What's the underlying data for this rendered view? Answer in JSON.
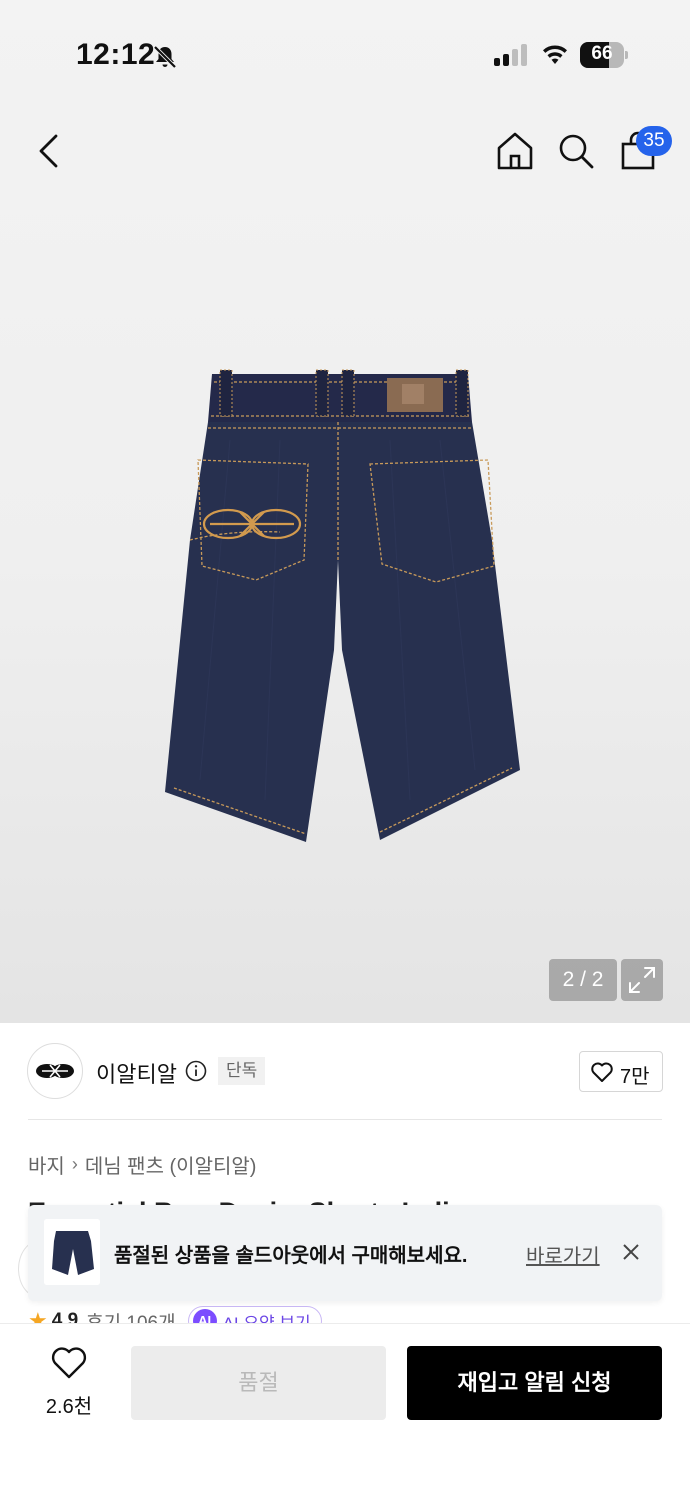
{
  "status_bar": {
    "time": "12:12",
    "battery": "66",
    "battery_level": 0.66
  },
  "header": {
    "cart_count": "35"
  },
  "gallery": {
    "counter": "2 / 2"
  },
  "brand": {
    "name": "이알티알",
    "tag": "단독",
    "likes": "7만"
  },
  "breadcrumb": {
    "level1": "바지",
    "level2": "데님 팬츠 (이알티알)"
  },
  "product": {
    "title_partial": "Essential Ba... Denim Shorts Indi..."
  },
  "rating": {
    "score": "4.9",
    "reviews": "후기 106개",
    "ai_label": "AI 요약 보기",
    "ai_badge": "AI"
  },
  "toast": {
    "message": "품절된 상품을 솔드아웃에서 구매해보세요.",
    "link": "바로가기"
  },
  "bottom_bar": {
    "wish_count": "2.6천",
    "soldout_label": "품절",
    "restock_label": "재입고 알림 신청"
  },
  "colors": {
    "accent_blue": "#2563eb",
    "ai_purple": "#7c4dff",
    "star": "#f5a623",
    "denim": "#27304f",
    "stitch": "#c89a5a"
  }
}
